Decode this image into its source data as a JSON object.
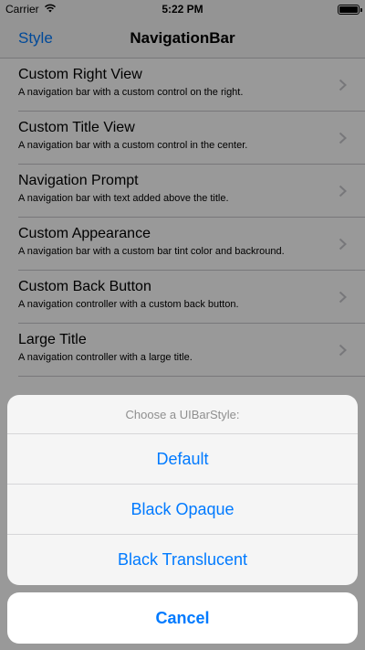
{
  "status_bar": {
    "carrier": "Carrier",
    "time": "5:22 PM",
    "wifi_icon": "wifi-icon",
    "battery_icon": "battery-icon",
    "battery_level": 1.0
  },
  "nav_bar": {
    "left_button": "Style",
    "title": "NavigationBar"
  },
  "list": {
    "items": [
      {
        "title": "Custom Right View",
        "subtitle": "A navigation bar with a custom control on the right."
      },
      {
        "title": "Custom Title View",
        "subtitle": "A navigation bar with a custom control in the center."
      },
      {
        "title": "Navigation Prompt",
        "subtitle": "A navigation bar with text added above the title."
      },
      {
        "title": "Custom Appearance",
        "subtitle": "A navigation bar with a custom bar tint color and backround."
      },
      {
        "title": "Custom Back Button",
        "subtitle": "A navigation controller with a custom back button."
      },
      {
        "title": "Large Title",
        "subtitle": "A navigation controller with a large title."
      }
    ],
    "accessory_icon": "chevron-right-icon"
  },
  "action_sheet": {
    "title": "Choose a UIBarStyle:",
    "actions": [
      {
        "label": "Default"
      },
      {
        "label": "Black Opaque"
      },
      {
        "label": "Black Translucent"
      }
    ],
    "cancel_label": "Cancel"
  },
  "colors": {
    "tint": "#007aff",
    "separator": "#c8c7cc",
    "overlay": "rgba(0,0,0,0.4)"
  }
}
